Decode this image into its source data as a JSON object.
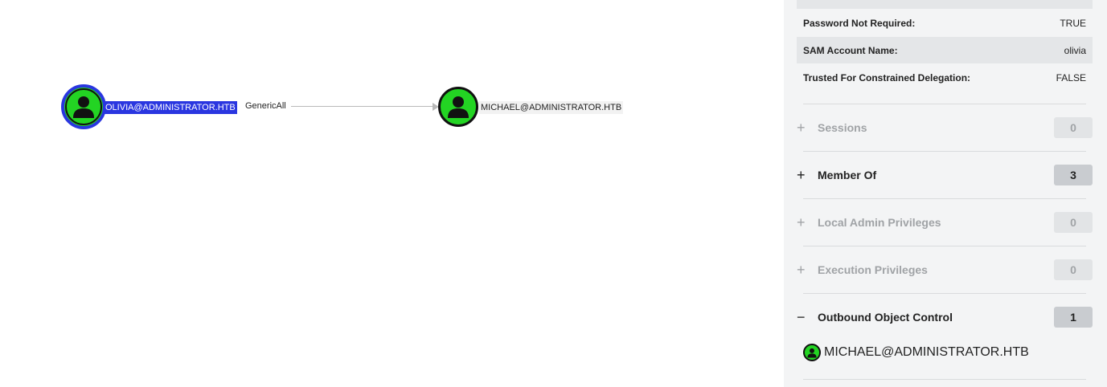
{
  "graph": {
    "edge_label": "GenericAll",
    "source_node": {
      "label": "OLIVIA@ADMINISTRATOR.HTB",
      "icon": "user-icon",
      "color": "#23d423",
      "selected": true
    },
    "target_node": {
      "label": "MICHAEL@ADMINISTRATOR.HTB",
      "icon": "user-icon",
      "color": "#23d423"
    },
    "selection_color": "#2a36e0"
  },
  "panel": {
    "properties": [
      {
        "key": "Password Not Required:",
        "value": "TRUE"
      },
      {
        "key": "SAM Account Name:",
        "value": "olivia"
      },
      {
        "key": "Trusted For Constrained Delegation:",
        "value": "FALSE"
      }
    ],
    "sections": [
      {
        "sign": "+",
        "title": "Sessions",
        "count": "0",
        "muted": true
      },
      {
        "sign": "+",
        "title": "Member Of",
        "count": "3",
        "muted": false
      },
      {
        "sign": "+",
        "title": "Local Admin Privileges",
        "count": "0",
        "muted": true
      },
      {
        "sign": "+",
        "title": "Execution Privileges",
        "count": "0",
        "muted": true
      },
      {
        "sign": "−",
        "title": "Outbound Object Control",
        "count": "1",
        "muted": false
      }
    ],
    "outbound_entries": [
      {
        "label": "MICHAEL@ADMINISTRATOR.HTB",
        "icon": "user-icon"
      }
    ]
  }
}
